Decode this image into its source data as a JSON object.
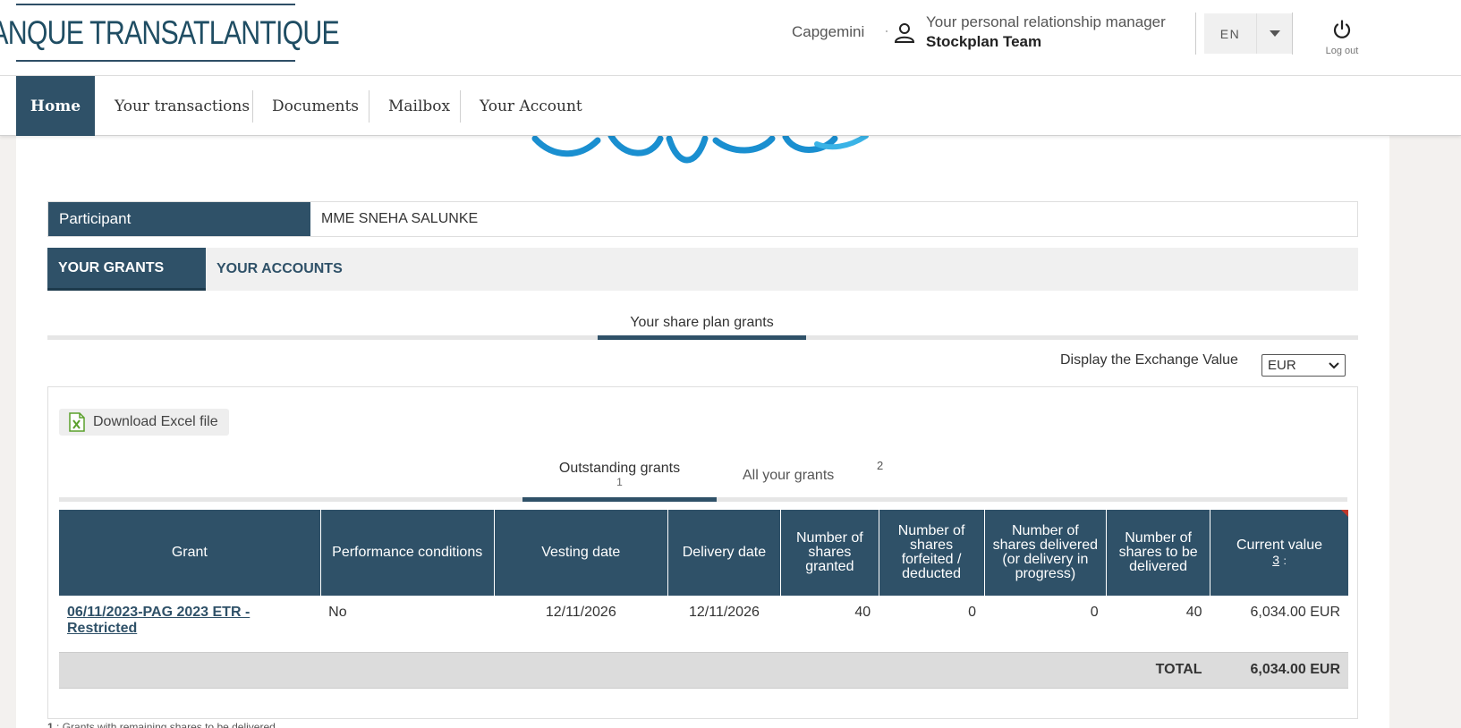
{
  "header": {
    "logo_text": "BANQUE TRANSATLANTIQUE",
    "company": "Capgemini",
    "relationship_manager_label": "Your personal relationship manager",
    "relationship_manager_name": "Stockplan Team",
    "language": "EN",
    "logout_label": "Log out"
  },
  "nav": {
    "items": [
      {
        "label": "Home"
      },
      {
        "label": "Your transactions"
      },
      {
        "label": "Documents"
      },
      {
        "label": "Mailbox"
      },
      {
        "label": "Your Account"
      }
    ]
  },
  "participant": {
    "label": "Participant",
    "value": "MME SNEHA SALUNKE"
  },
  "tabs": {
    "grants": "YOUR GRANTS",
    "accounts": "YOUR ACCOUNTS"
  },
  "subtab": "Your share plan grants",
  "exchange": {
    "label": "Display the Exchange Value",
    "selected": "EUR"
  },
  "download_label": "Download Excel file",
  "grant_tabs": {
    "outstanding": "Outstanding grants",
    "outstanding_note": "1",
    "all": "All your grants",
    "all_note": "2"
  },
  "table": {
    "headers": [
      "Grant",
      "Performance conditions",
      "Vesting date",
      "Delivery date",
      "Number of shares granted",
      "Number of shares forfeited / deducted",
      "Number of shares delivered (or delivery in progress)",
      "Number of shares to be delivered",
      "Current value"
    ],
    "current_value_note": "3",
    "current_value_note_suffix": ":",
    "rows": [
      {
        "grant": "06/11/2023-PAG 2023 ETR - Restricted",
        "performance": "No",
        "vesting": "12/11/2026",
        "delivery": "12/11/2026",
        "granted": "40",
        "forfeited": "0",
        "delivered": "0",
        "to_deliver": "40",
        "value": "6,034.00 EUR"
      }
    ],
    "total_label": "TOTAL",
    "total_value": "6,034.00 EUR"
  },
  "footnote": {
    "marker": "1",
    "text": ": Grants with remaining shares to be delivered"
  }
}
